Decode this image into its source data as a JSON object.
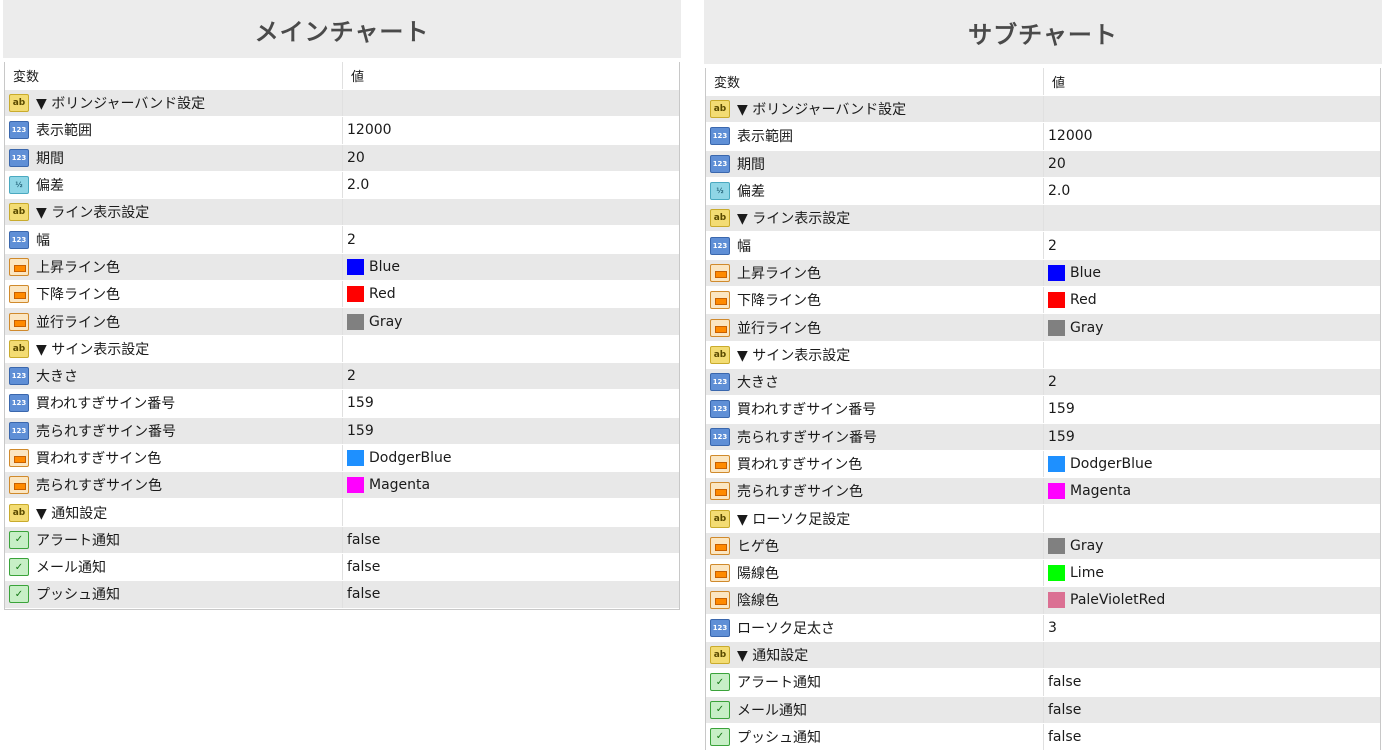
{
  "main": {
    "title": "メインチャート",
    "header": {
      "name": "変数",
      "value": "値"
    },
    "rows": [
      {
        "icon": "ab",
        "name": "▼ ボリンジャーバンド設定",
        "value": ""
      },
      {
        "icon": "num",
        "name": "表示範囲",
        "value": "12000"
      },
      {
        "icon": "num",
        "name": "期間",
        "value": "20"
      },
      {
        "icon": "dbl",
        "name": "偏差",
        "value": "2.0"
      },
      {
        "icon": "ab",
        "name": "▼ ライン表示設定",
        "value": ""
      },
      {
        "icon": "num",
        "name": "幅",
        "value": "2"
      },
      {
        "icon": "clr",
        "name": "上昇ライン色",
        "value": "Blue",
        "color": "#0000ff"
      },
      {
        "icon": "clr",
        "name": "下降ライン色",
        "value": "Red",
        "color": "#ff0000"
      },
      {
        "icon": "clr",
        "name": "並行ライン色",
        "value": "Gray",
        "color": "#808080"
      },
      {
        "icon": "ab",
        "name": "▼ サイン表示設定",
        "value": ""
      },
      {
        "icon": "num",
        "name": "大きさ",
        "value": "2"
      },
      {
        "icon": "num",
        "name": "買われすぎサイン番号",
        "value": "159"
      },
      {
        "icon": "num",
        "name": "売られすぎサイン番号",
        "value": "159"
      },
      {
        "icon": "clr",
        "name": "買われすぎサイン色",
        "value": "DodgerBlue",
        "color": "#1e90ff"
      },
      {
        "icon": "clr",
        "name": "売られすぎサイン色",
        "value": "Magenta",
        "color": "#ff00ff"
      },
      {
        "icon": "ab",
        "name": "▼ 通知設定",
        "value": ""
      },
      {
        "icon": "bool",
        "name": "アラート通知",
        "value": "false"
      },
      {
        "icon": "bool",
        "name": "メール通知",
        "value": "false"
      },
      {
        "icon": "bool",
        "name": "プッシュ通知",
        "value": "false"
      }
    ]
  },
  "sub": {
    "title": "サブチャート",
    "header": {
      "name": "変数",
      "value": "値"
    },
    "rows": [
      {
        "icon": "ab",
        "name": "▼ ボリンジャーバンド設定",
        "value": ""
      },
      {
        "icon": "num",
        "name": "表示範囲",
        "value": "12000"
      },
      {
        "icon": "num",
        "name": "期間",
        "value": "20"
      },
      {
        "icon": "dbl",
        "name": "偏差",
        "value": "2.0"
      },
      {
        "icon": "ab",
        "name": "▼ ライン表示設定",
        "value": ""
      },
      {
        "icon": "num",
        "name": "幅",
        "value": "2"
      },
      {
        "icon": "clr",
        "name": "上昇ライン色",
        "value": "Blue",
        "color": "#0000ff"
      },
      {
        "icon": "clr",
        "name": "下降ライン色",
        "value": "Red",
        "color": "#ff0000"
      },
      {
        "icon": "clr",
        "name": "並行ライン色",
        "value": "Gray",
        "color": "#808080"
      },
      {
        "icon": "ab",
        "name": "▼ サイン表示設定",
        "value": ""
      },
      {
        "icon": "num",
        "name": "大きさ",
        "value": "2"
      },
      {
        "icon": "num",
        "name": "買われすぎサイン番号",
        "value": "159"
      },
      {
        "icon": "num",
        "name": "売られすぎサイン番号",
        "value": "159"
      },
      {
        "icon": "clr",
        "name": "買われすぎサイン色",
        "value": "DodgerBlue",
        "color": "#1e90ff"
      },
      {
        "icon": "clr",
        "name": "売られすぎサイン色",
        "value": "Magenta",
        "color": "#ff00ff"
      },
      {
        "icon": "ab",
        "name": "▼ ローソク足設定",
        "value": ""
      },
      {
        "icon": "clr",
        "name": "ヒゲ色",
        "value": "Gray",
        "color": "#808080"
      },
      {
        "icon": "clr",
        "name": "陽線色",
        "value": "Lime",
        "color": "#00ff00"
      },
      {
        "icon": "clr",
        "name": "陰線色",
        "value": "PaleVioletRed",
        "color": "#db7093"
      },
      {
        "icon": "num",
        "name": "ローソク足太さ",
        "value": "3"
      },
      {
        "icon": "ab",
        "name": "▼ 通知設定",
        "value": ""
      },
      {
        "icon": "bool",
        "name": "アラート通知",
        "value": "false"
      },
      {
        "icon": "bool",
        "name": "メール通知",
        "value": "false"
      },
      {
        "icon": "bool",
        "name": "プッシュ通知",
        "value": "false"
      }
    ]
  }
}
